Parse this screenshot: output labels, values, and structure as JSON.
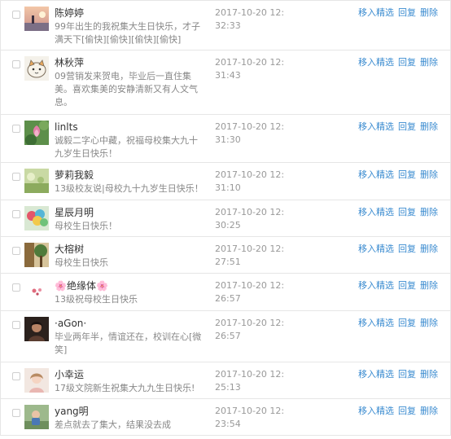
{
  "actions": {
    "feature": "移入精选",
    "reply": "回复",
    "delete": "删除"
  },
  "comments": [
    {
      "name": "陈婷婷",
      "message": "99年出生的我祝集大生日快乐，才子满天下[偷快][偷快][偷快][偷快]",
      "time": "2017-10-20 12:32:33",
      "avatar": "avatar-sunset-icon"
    },
    {
      "name": "林秋萍",
      "message": "09营销发来贺电，毕业后一直住集美。喜欢集美的安静清新又有人文气息。",
      "time": "2017-10-20 12:31:43",
      "avatar": "avatar-cat-icon"
    },
    {
      "name": "linlts",
      "message": "诚毅二字心中藏，祝福母校集大九十九岁生日快乐！",
      "time": "2017-10-20 12:31:30",
      "avatar": "avatar-lotus-icon"
    },
    {
      "name": "萝莉我毅",
      "message": "13级校友说|母校九十九岁生日快乐！",
      "time": "2017-10-20 12:31:10",
      "avatar": "avatar-field-icon"
    },
    {
      "name": "星辰月明",
      "message": "母校生日快乐！",
      "time": "2017-10-20 12:30:25",
      "avatar": "avatar-balloons-icon"
    },
    {
      "name": "大榕树",
      "message": "母校生日快乐",
      "time": "2017-10-20 12:27:51",
      "avatar": "avatar-tree-icon"
    },
    {
      "name": "🌸绝缘体🌸",
      "message": "13级祝母校生日快乐",
      "time": "2017-10-20 12:26:57",
      "avatar": "avatar-flower-icon"
    },
    {
      "name": "·aGon·",
      "message": "毕业两年半，情谊还在，校训在心[微笑]",
      "time": "2017-10-20 12:26:57",
      "avatar": "avatar-portrait-icon"
    },
    {
      "name": "小幸运",
      "message": "17级文院新生祝集大九九生日快乐!",
      "time": "2017-10-20 12:25:13",
      "avatar": "avatar-girl-icon"
    },
    {
      "name": "yang明",
      "message": "差点就去了集大，结果没去成",
      "time": "2017-10-20 12:23:54",
      "avatar": "avatar-child-icon"
    }
  ]
}
